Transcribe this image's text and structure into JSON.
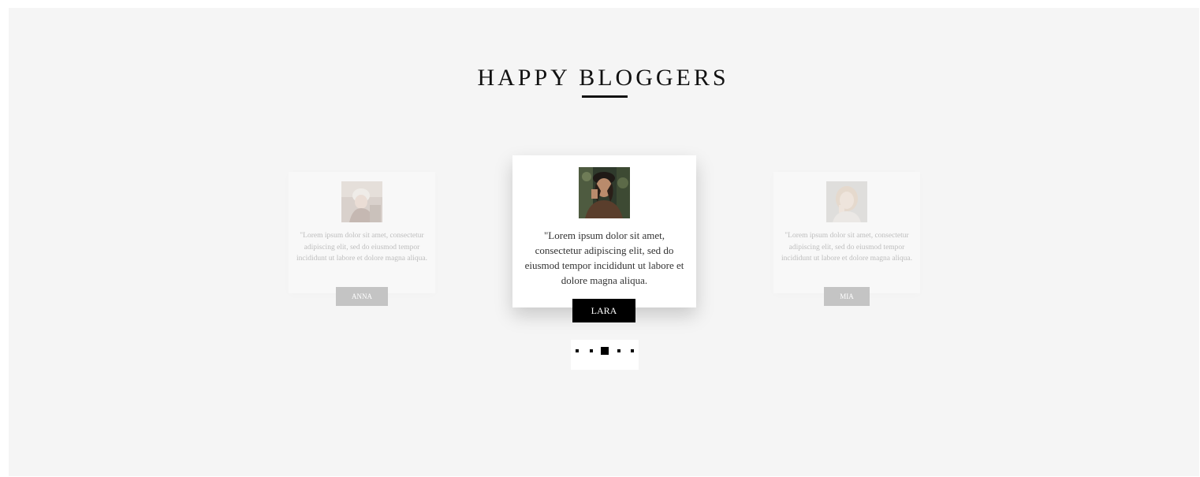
{
  "section": {
    "title": "HAPPY BLOGGERS"
  },
  "testimonials": [
    {
      "name": "ANNA",
      "quote": "\"Lorem ipsum dolor sit amet, consectetur adipiscing elit, sed do eiusmod tempor incididunt ut labore et dolore magna aliqua.",
      "state": "inactive"
    },
    {
      "name": "LARA",
      "quote": "\"Lorem ipsum dolor sit amet, consectetur adipiscing elit, sed do eiusmod tempor incididunt ut labore et dolore magna aliqua.",
      "state": "active"
    },
    {
      "name": "MIA",
      "quote": "\"Lorem ipsum dolor sit amet, consectetur adipiscing elit, sed do eiusmod tempor incididunt ut labore et dolore magna aliqua.",
      "state": "inactive"
    }
  ],
  "pagination": {
    "count": 5,
    "active_index": 2
  },
  "colors": {
    "background": "#f5f5f5",
    "accent": "#000000",
    "inactive_tag": "#c4c4c4"
  }
}
